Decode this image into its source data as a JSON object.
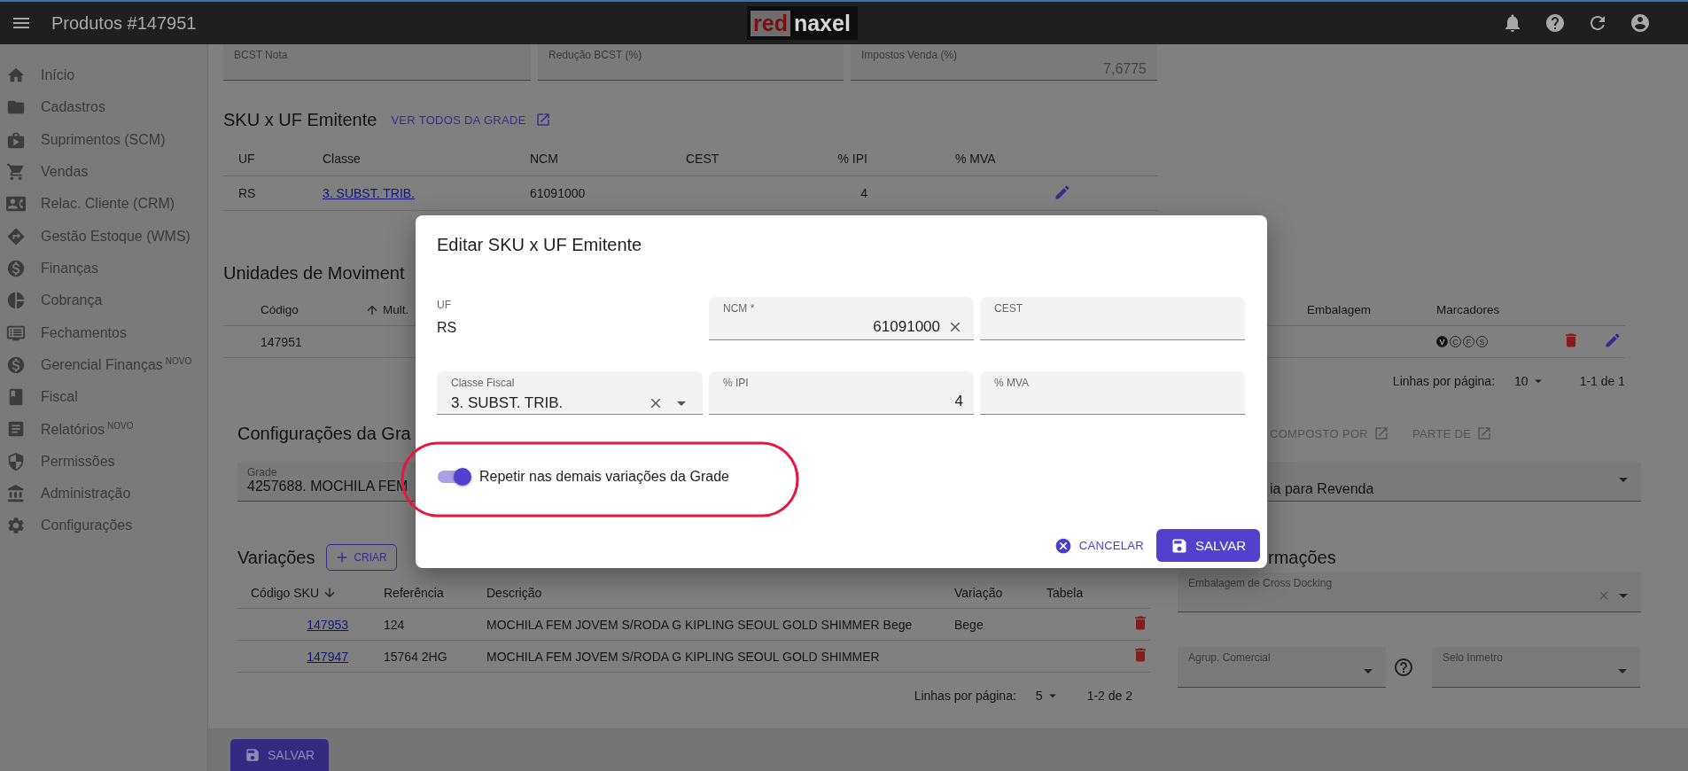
{
  "topbar": {
    "title": "Produtos #147951",
    "logo": [
      "red",
      "naxel"
    ]
  },
  "sidebar": {
    "items": [
      {
        "label": "Início"
      },
      {
        "label": "Cadastros"
      },
      {
        "label": "Suprimentos (SCM)"
      },
      {
        "label": "Vendas"
      },
      {
        "label": "Relac. Cliente (CRM)"
      },
      {
        "label": "Gestão Estoque (WMS)"
      },
      {
        "label": "Finanças"
      },
      {
        "label": "Cobrança"
      },
      {
        "label": "Fechamentos"
      },
      {
        "label": "Gerencial Finanças",
        "badge": "NOVO"
      },
      {
        "label": "Fiscal"
      },
      {
        "label": "Relatórios",
        "badge": "NOVO"
      },
      {
        "label": "Permissões"
      },
      {
        "label": "Administração"
      },
      {
        "label": "Configurações"
      }
    ]
  },
  "tax_fields": [
    {
      "label": "BCST Nota"
    },
    {
      "label": "Redução BCST (%)"
    },
    {
      "label": "Impostos Venda (%)",
      "value": "7,6775"
    }
  ],
  "sku_uf": {
    "title": "SKU x UF Emitente",
    "link": "VER TODOS DA GRADE",
    "columns": [
      "UF",
      "Classe",
      "NCM",
      "CEST",
      "% IPI",
      "% MVA"
    ],
    "rows": [
      {
        "uf": "RS",
        "classe": "3. SUBST. TRIB.",
        "ncm": "61091000",
        "ipi": "4"
      }
    ]
  },
  "units": {
    "title": "Unidades de Moviment",
    "columns": [
      {
        "label": "Código",
        "sorted": false
      },
      {
        "label": "Mult.",
        "sorted": true,
        "ascending": true
      }
    ],
    "right_columns": [
      "Embalagem",
      "Marcadores"
    ],
    "rows": [
      {
        "code": "147951",
        "markers": [
          {
            "letter": "V",
            "on": true
          },
          {
            "letter": "C",
            "on": false
          },
          {
            "letter": "F",
            "on": false
          },
          {
            "letter": "S",
            "on": false
          }
        ]
      }
    ],
    "pagination": {
      "label": "Linhas por página:",
      "per_page": "10",
      "range": "1-1 de 1"
    }
  },
  "grade_config": {
    "title": "Configurações da Gra",
    "links": [
      "COMPOSTO POR",
      "PARTE DE"
    ],
    "grade": {
      "label": "Grade",
      "value": "4257688. MOCHILA FEM"
    },
    "type_value": "ia para Revenda"
  },
  "variations": {
    "title": "Variações",
    "create": "CRIAR",
    "columns": [
      {
        "label": "Código SKU",
        "sorted": true,
        "ascending": false
      },
      {
        "label": "Referência",
        "sorted": false
      },
      {
        "label": "Descrição",
        "sorted": false
      },
      {
        "label": "Variação",
        "sorted": false
      },
      {
        "label": "Tabela",
        "sorted": false
      }
    ],
    "rows": [
      {
        "sku": "147953",
        "ref": "124",
        "desc": "MOCHILA FEM JOVEM S/RODA G KIPLING SEOUL GOLD SHIMMER Bege",
        "variation": "Bege"
      },
      {
        "sku": "147947",
        "ref": "15764 2HG",
        "desc": "MOCHILA FEM JOVEM S/RODA G KIPLING SEOUL GOLD SHIMMER"
      }
    ],
    "pagination": {
      "label": "Linhas por página:",
      "per_page": "5",
      "range": "1-2 de 2"
    }
  },
  "info": {
    "title": "rmações",
    "cross_docking": {
      "label": "Embalagem de Cross Docking"
    },
    "group": {
      "label": "Agrup. Comercial"
    },
    "seal": {
      "label": "Selo Inmetro"
    }
  },
  "footer": {
    "save": "SALVAR"
  },
  "dialog": {
    "title": "Editar SKU x UF Emitente",
    "uf": {
      "label": "UF",
      "value": "RS"
    },
    "fields": [
      {
        "label": "NCM *",
        "value": "61091000",
        "clearable": true,
        "select": false
      },
      {
        "label": "CEST",
        "clearable": false,
        "select": false
      },
      {
        "label": "Classe Fiscal",
        "value": "3. SUBST. TRIB.",
        "clearable": true,
        "select": true
      },
      {
        "label": "% IPI",
        "value": "4",
        "clearable": false,
        "select": false
      },
      {
        "label": "% MVA",
        "clearable": false,
        "select": false
      }
    ],
    "toggle": {
      "label": "Repetir nas demais variações da Grade",
      "on": true
    },
    "cancel": "CANCELAR",
    "save": "SALVAR"
  }
}
